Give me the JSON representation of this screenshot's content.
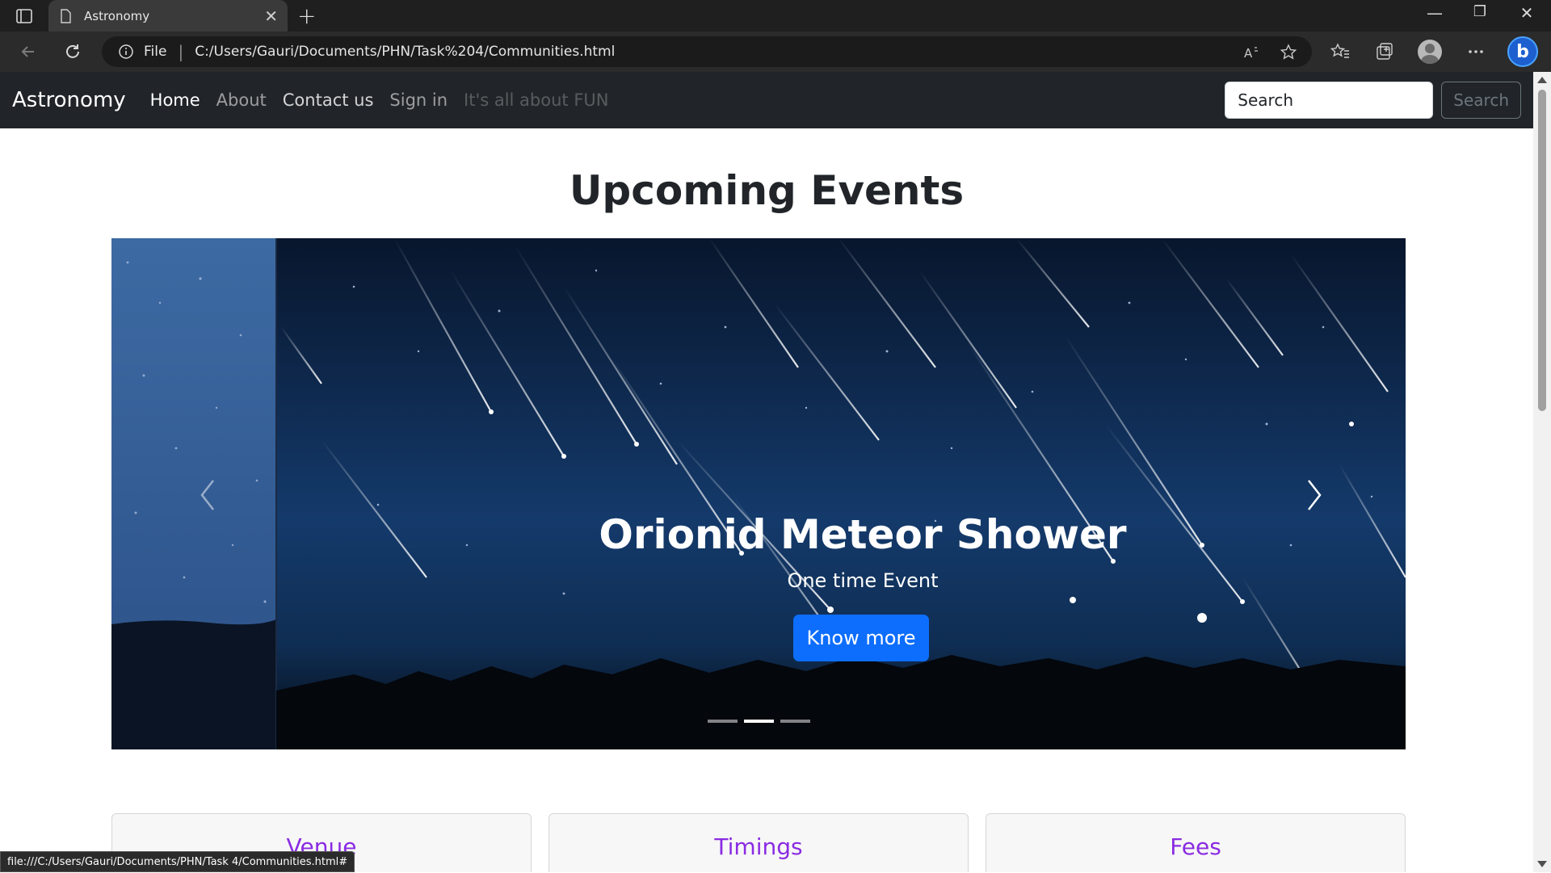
{
  "browser": {
    "tab_title": "Astronomy",
    "file_label": "File",
    "url": "C:/Users/Gauri/Documents/PHN/Task%204/Communities.html",
    "status_url": "file:///C:/Users/Gauri/Documents/PHN/Task 4/Communities.html#"
  },
  "navbar": {
    "brand": "Astronomy",
    "links": [
      "Home",
      "About",
      "Contact us",
      "Sign in",
      "It's all about FUN"
    ],
    "search_placeholder": "Search",
    "search_button": "Search"
  },
  "main": {
    "heading": "Upcoming Events",
    "carousel": {
      "title": "Orionid Meteor Shower",
      "subtitle": "One time Event",
      "button": "Know more",
      "active_index": 1,
      "slide_count": 3
    },
    "cards": [
      "Venue",
      "Timings",
      "Fees"
    ]
  },
  "colors": {
    "navbar_bg": "#212529",
    "primary": "#0d6efd",
    "card_title": "#8a2be2"
  }
}
